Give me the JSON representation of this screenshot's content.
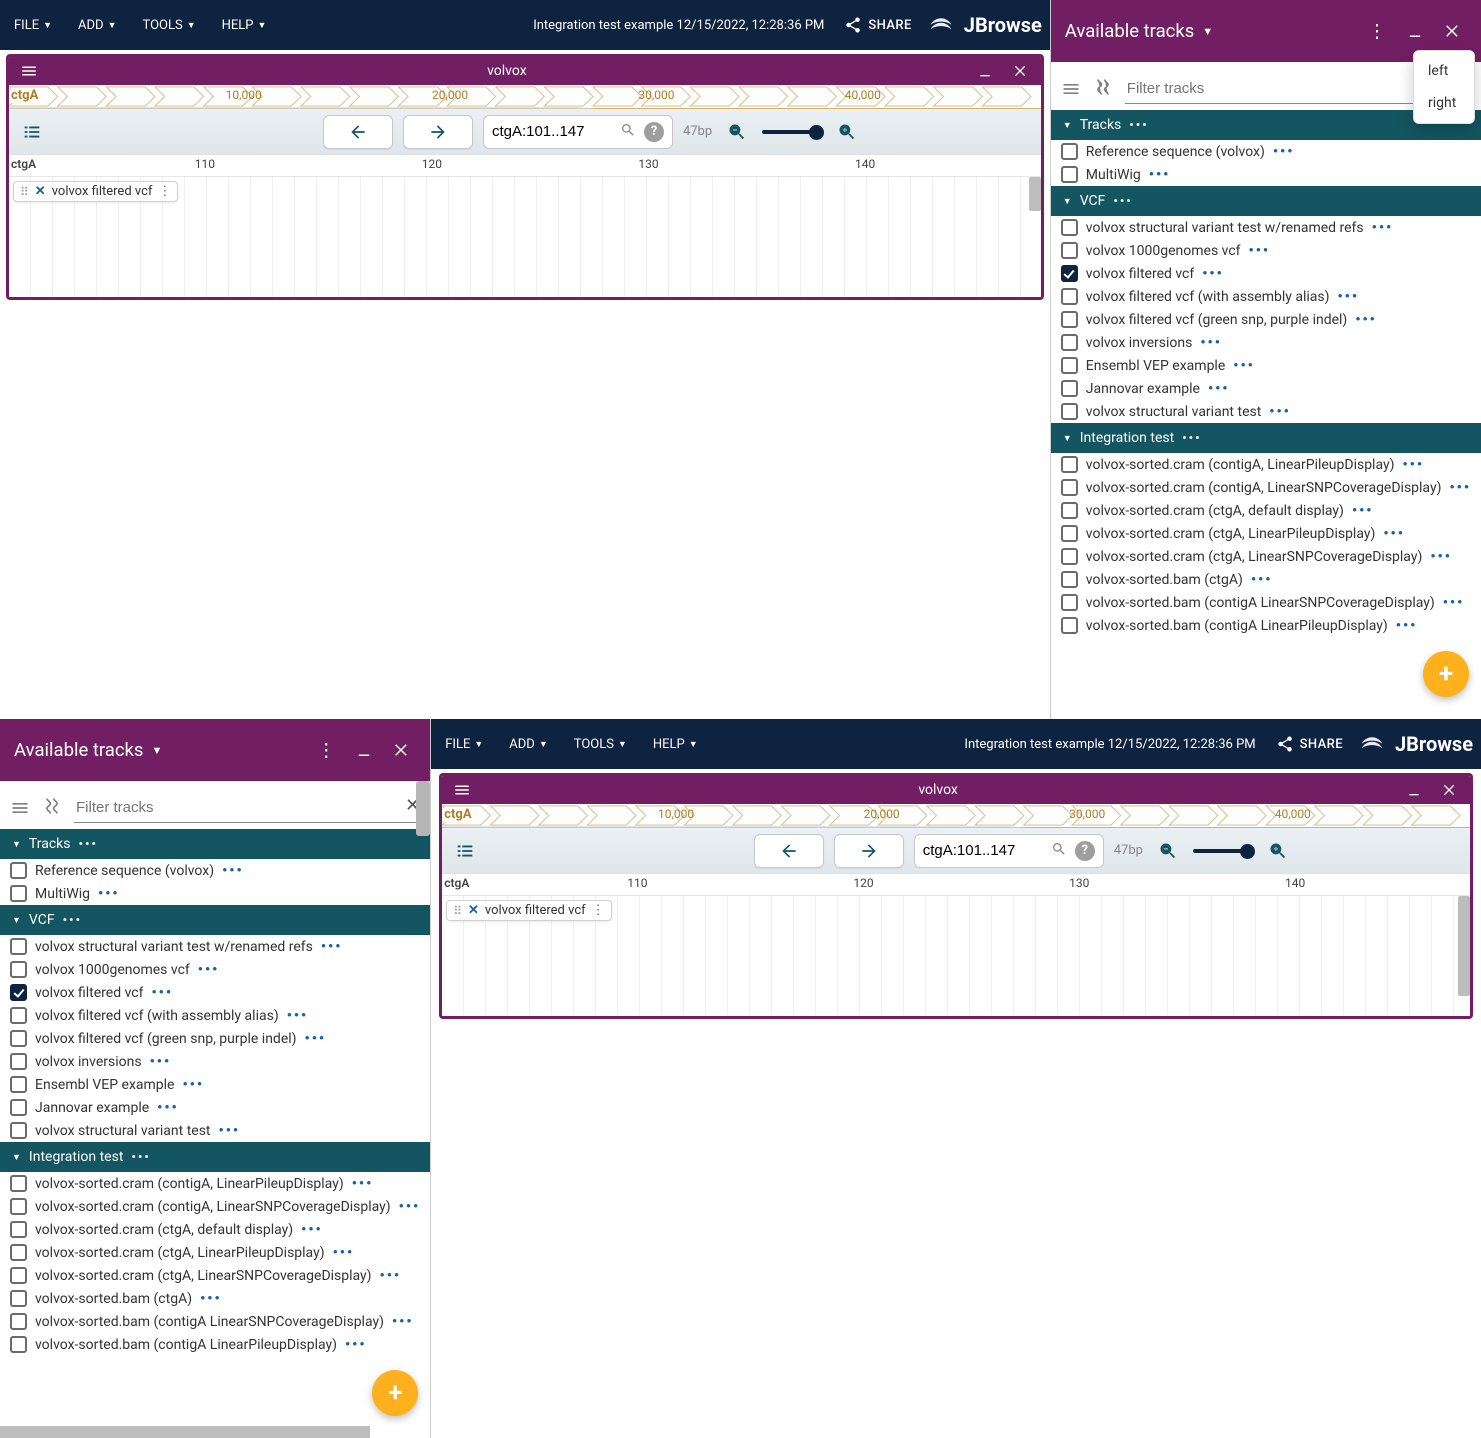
{
  "app": {
    "session_title": "Integration test example 12/15/2022, 12:28:36 PM",
    "share_label": "SHARE",
    "logo_text": "JBrowse",
    "menus": [
      {
        "label": "FILE"
      },
      {
        "label": "ADD"
      },
      {
        "label": "TOOLS"
      },
      {
        "label": "HELP"
      }
    ]
  },
  "popover": {
    "options": [
      "left",
      "right"
    ]
  },
  "side_panel": {
    "title": "Available tracks",
    "filter_placeholder": "Filter tracks",
    "categories": [
      {
        "name": "Tracks",
        "tracks": [
          {
            "label": "Reference sequence (volvox)",
            "checked": false
          },
          {
            "label": "MultiWig",
            "checked": false
          }
        ]
      },
      {
        "name": "VCF",
        "tracks": [
          {
            "label": "volvox structural variant test w/renamed refs",
            "checked": false
          },
          {
            "label": "volvox 1000genomes vcf",
            "checked": false
          },
          {
            "label": "volvox filtered vcf",
            "checked": true
          },
          {
            "label": "volvox filtered vcf (with assembly alias)",
            "checked": false
          },
          {
            "label": "volvox filtered vcf (green snp, purple indel)",
            "checked": false
          },
          {
            "label": "volvox inversions",
            "checked": false
          },
          {
            "label": "Ensembl VEP example",
            "checked": false
          },
          {
            "label": "Jannovar example",
            "checked": false
          },
          {
            "label": "volvox structural variant test",
            "checked": false
          }
        ]
      },
      {
        "name": "Integration test",
        "tracks": [
          {
            "label": "volvox-sorted.cram (contigA, LinearPileupDisplay)",
            "checked": false
          },
          {
            "label": "volvox-sorted.cram (contigA, LinearSNPCoverageDisplay)",
            "checked": false
          },
          {
            "label": "volvox-sorted.cram (ctgA, default display)",
            "checked": false
          },
          {
            "label": "volvox-sorted.cram (ctgA, LinearPileupDisplay)",
            "checked": false
          },
          {
            "label": "volvox-sorted.cram (ctgA, LinearSNPCoverageDisplay)",
            "checked": false
          },
          {
            "label": "volvox-sorted.bam (ctgA)",
            "checked": false
          },
          {
            "label": "volvox-sorted.bam (contigA LinearSNPCoverageDisplay)",
            "checked": false
          },
          {
            "label": "volvox-sorted.bam (contigA LinearPileupDisplay)",
            "checked": false
          }
        ]
      }
    ]
  },
  "view": {
    "title": "volvox",
    "overview_refname": "ctgA",
    "overview_ticks": [
      "10,000",
      "20,000",
      "30,000",
      "40,000"
    ],
    "location_value": "ctgA:101..147",
    "bp_label": "47bp",
    "coord_refname": "ctgA",
    "coord_ticks": [
      "110",
      "120",
      "130",
      "140"
    ],
    "track_chip_label": "volvox filtered vcf"
  }
}
